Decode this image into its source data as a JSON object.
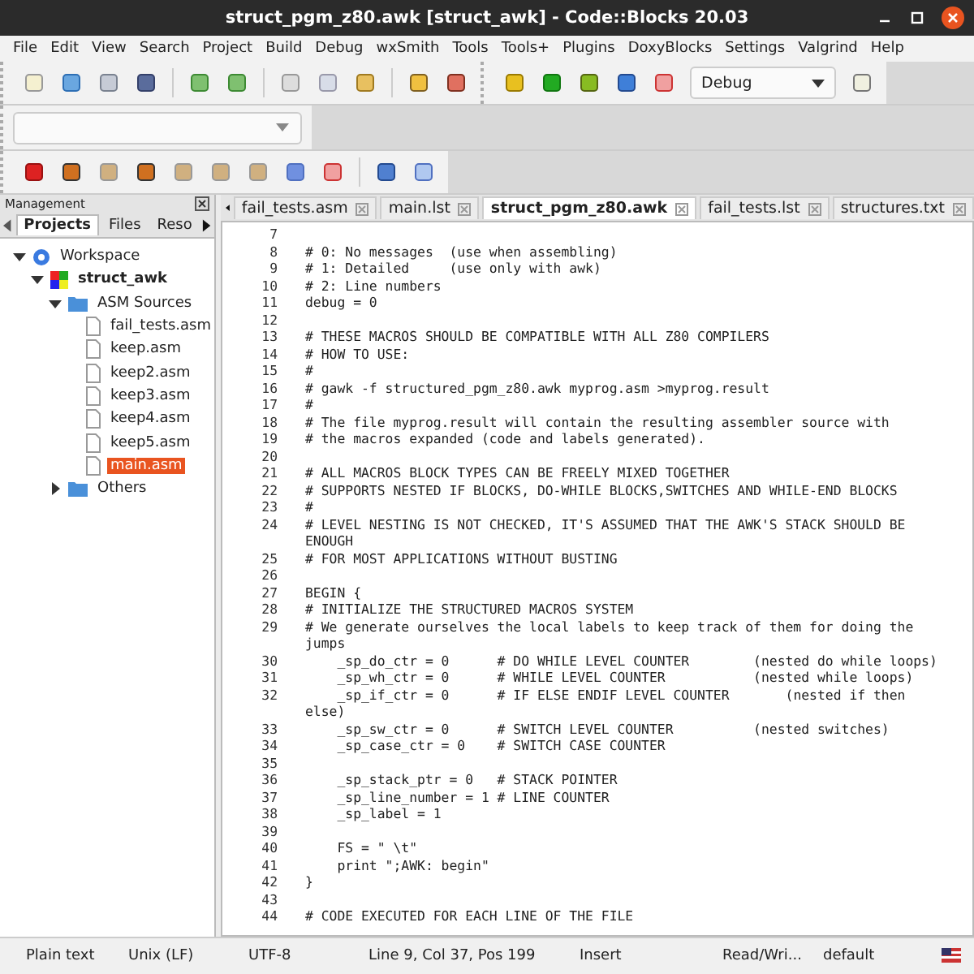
{
  "window": {
    "title": "struct_pgm_z80.awk [struct_awk] - Code::Blocks 20.03"
  },
  "menu": [
    "File",
    "Edit",
    "View",
    "Search",
    "Project",
    "Build",
    "Debug",
    "wxSmith",
    "Tools",
    "Tools+",
    "Plugins",
    "DoxyBlocks",
    "Settings",
    "Valgrind",
    "Help"
  ],
  "toolbar": {
    "build_target": "Debug"
  },
  "management": {
    "title": "Management",
    "tabs": [
      {
        "label": "Projects",
        "selected": true
      },
      {
        "label": "Files",
        "selected": false
      },
      {
        "label": "Reso",
        "selected": false
      }
    ],
    "tree": [
      {
        "label": "Workspace",
        "kind": "workspace",
        "expanded": true,
        "selected": false,
        "children": [
          {
            "label": "struct_awk",
            "kind": "project",
            "expanded": true,
            "selected": false,
            "children": [
              {
                "label": "ASM Sources",
                "kind": "folder",
                "expanded": true,
                "selected": false,
                "children": [
                  {
                    "label": "fail_tests.asm",
                    "kind": "file",
                    "selected": false
                  },
                  {
                    "label": "keep.asm",
                    "kind": "file",
                    "selected": false
                  },
                  {
                    "label": "keep2.asm",
                    "kind": "file",
                    "selected": false
                  },
                  {
                    "label": "keep3.asm",
                    "kind": "file",
                    "selected": false
                  },
                  {
                    "label": "keep4.asm",
                    "kind": "file",
                    "selected": false
                  },
                  {
                    "label": "keep5.asm",
                    "kind": "file",
                    "selected": false
                  },
                  {
                    "label": "main.asm",
                    "kind": "file",
                    "selected": true
                  }
                ]
              },
              {
                "label": "Others",
                "kind": "folder",
                "expanded": false,
                "selected": false
              }
            ]
          }
        ]
      }
    ]
  },
  "editor": {
    "tabs": [
      {
        "label": "fail_tests.asm",
        "selected": false
      },
      {
        "label": "main.lst",
        "selected": false
      },
      {
        "label": "struct_pgm_z80.awk",
        "selected": true
      },
      {
        "label": "fail_tests.lst",
        "selected": false
      },
      {
        "label": "structures.txt",
        "selected": false
      }
    ],
    "lines": [
      {
        "number": "7"
      },
      {
        "number": "8",
        "text": "# 0: No messages  (use when assembling)"
      },
      {
        "number": "9",
        "text": "# 1: Detailed     (use only with awk)"
      },
      {
        "number": "10",
        "text": "# 2: Line numbers"
      },
      {
        "number": "11",
        "text": "debug = 0"
      },
      {
        "number": "12"
      },
      {
        "number": "13",
        "text": "# THESE MACROS SHOULD BE COMPATIBLE WITH ALL Z80 COMPILERS"
      },
      {
        "number": "14",
        "text": "# HOW TO USE:"
      },
      {
        "number": "15",
        "text": "#"
      },
      {
        "number": "16",
        "text": "# gawk -f structured_pgm_z80.awk myprog.asm >myprog.result"
      },
      {
        "number": "17",
        "text": "#"
      },
      {
        "number": "18",
        "text": "# The file myprog.result will contain the resulting assembler source with"
      },
      {
        "number": "19",
        "text": "# the macros expanded (code and labels generated)."
      },
      {
        "number": "20"
      },
      {
        "number": "21",
        "text": "# ALL MACROS BLOCK TYPES CAN BE FREELY MIXED TOGETHER"
      },
      {
        "number": "22",
        "text": "# SUPPORTS NESTED IF BLOCKS, DO-WHILE BLOCKS,SWITCHES AND WHILE-END BLOCKS"
      },
      {
        "number": "23",
        "text": "#"
      },
      {
        "number": "24",
        "text": "# LEVEL NESTING IS NOT CHECKED, IT'S ASSUMED THAT THE AWK'S STACK SHOULD BE ENOUGH"
      },
      {
        "number": "25",
        "text": "# FOR MOST APPLICATIONS WITHOUT BUSTING"
      },
      {
        "number": "26"
      },
      {
        "number": "27",
        "text": "BEGIN {"
      },
      {
        "number": "28",
        "text": "# INITIALIZE THE STRUCTURED MACROS SYSTEM"
      },
      {
        "number": "29",
        "text": "# We generate ourselves the local labels to keep track of them for doing the jumps"
      },
      {
        "number": "30",
        "text": "    _sp_do_ctr = 0      # DO WHILE LEVEL COUNTER        (nested do while loops)"
      },
      {
        "number": "31",
        "text": "    _sp_wh_ctr = 0      # WHILE LEVEL COUNTER           (nested while loops)"
      },
      {
        "number": "32",
        "text": "    _sp_if_ctr = 0      # IF ELSE ENDIF LEVEL COUNTER       (nested if then else)"
      },
      {
        "number": "33",
        "text": "    _sp_sw_ctr = 0      # SWITCH LEVEL COUNTER          (nested switches)"
      },
      {
        "number": "34",
        "text": "    _sp_case_ctr = 0    # SWITCH CASE COUNTER"
      },
      {
        "number": "35"
      },
      {
        "number": "36",
        "text": "    _sp_stack_ptr = 0   # STACK POINTER"
      },
      {
        "number": "37",
        "text": "    _sp_line_number = 1 # LINE COUNTER"
      },
      {
        "number": "38",
        "text": "    _sp_label = 1"
      },
      {
        "number": "39"
      },
      {
        "number": "40",
        "text": "    FS = \" \\t\""
      },
      {
        "number": "41",
        "text": "    print \";AWK: begin\""
      },
      {
        "number": "42",
        "text": "}"
      },
      {
        "number": "43"
      },
      {
        "number": "44",
        "text": "# CODE EXECUTED FOR EACH LINE OF THE FILE"
      }
    ]
  },
  "status_bar": [
    "Plain text",
    "Unix (LF)",
    "UTF-8",
    "Line 9, Col 37, Pos 199",
    "Insert",
    "Read/Wri...",
    "default"
  ]
}
